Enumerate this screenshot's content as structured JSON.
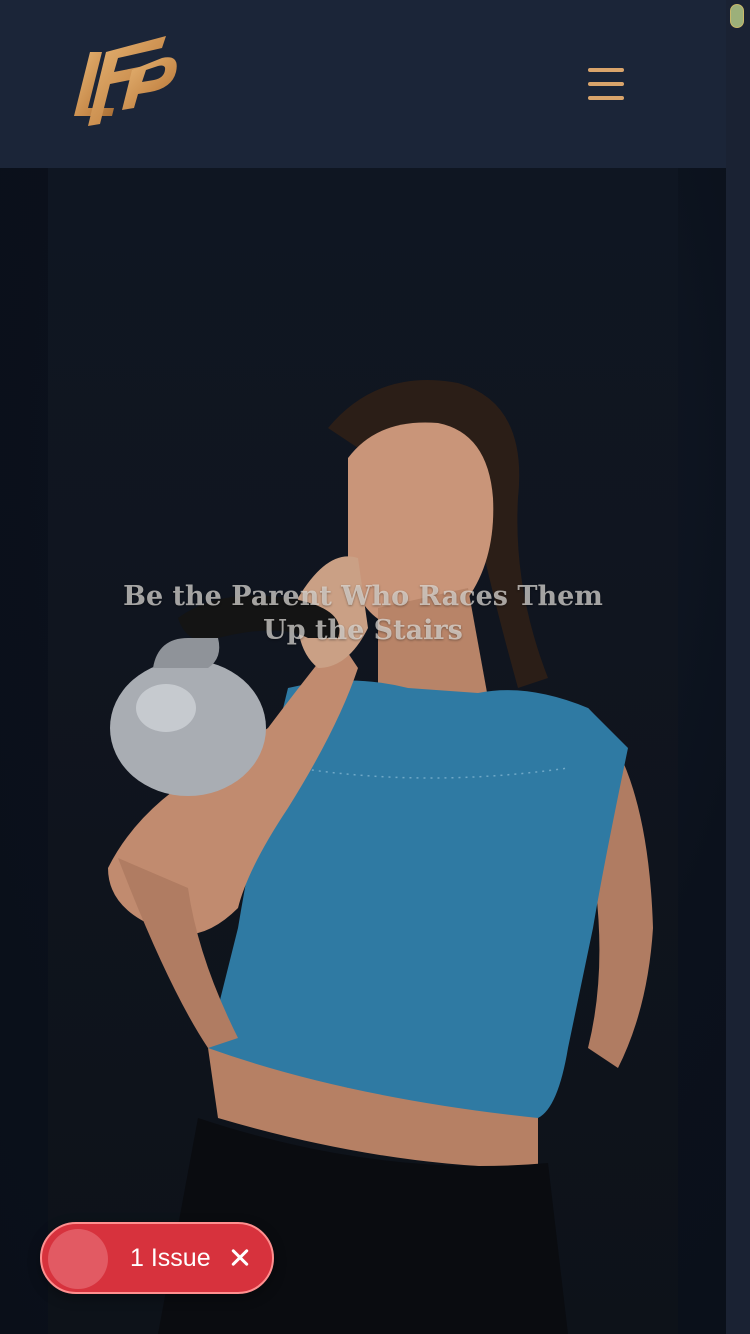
{
  "header": {
    "logo_text": "LFP",
    "menu_icon": "hamburger-menu-icon",
    "accent_color": "#d9a46b",
    "background_color": "#1b2538"
  },
  "hero": {
    "title": "Be the Parent Who Races Them Up the Stairs",
    "image_description_icon": "woman-kettlebell-photo"
  },
  "issue_badge": {
    "label": "1 Issue",
    "close_icon": "close-icon",
    "color": "#d7323d"
  }
}
